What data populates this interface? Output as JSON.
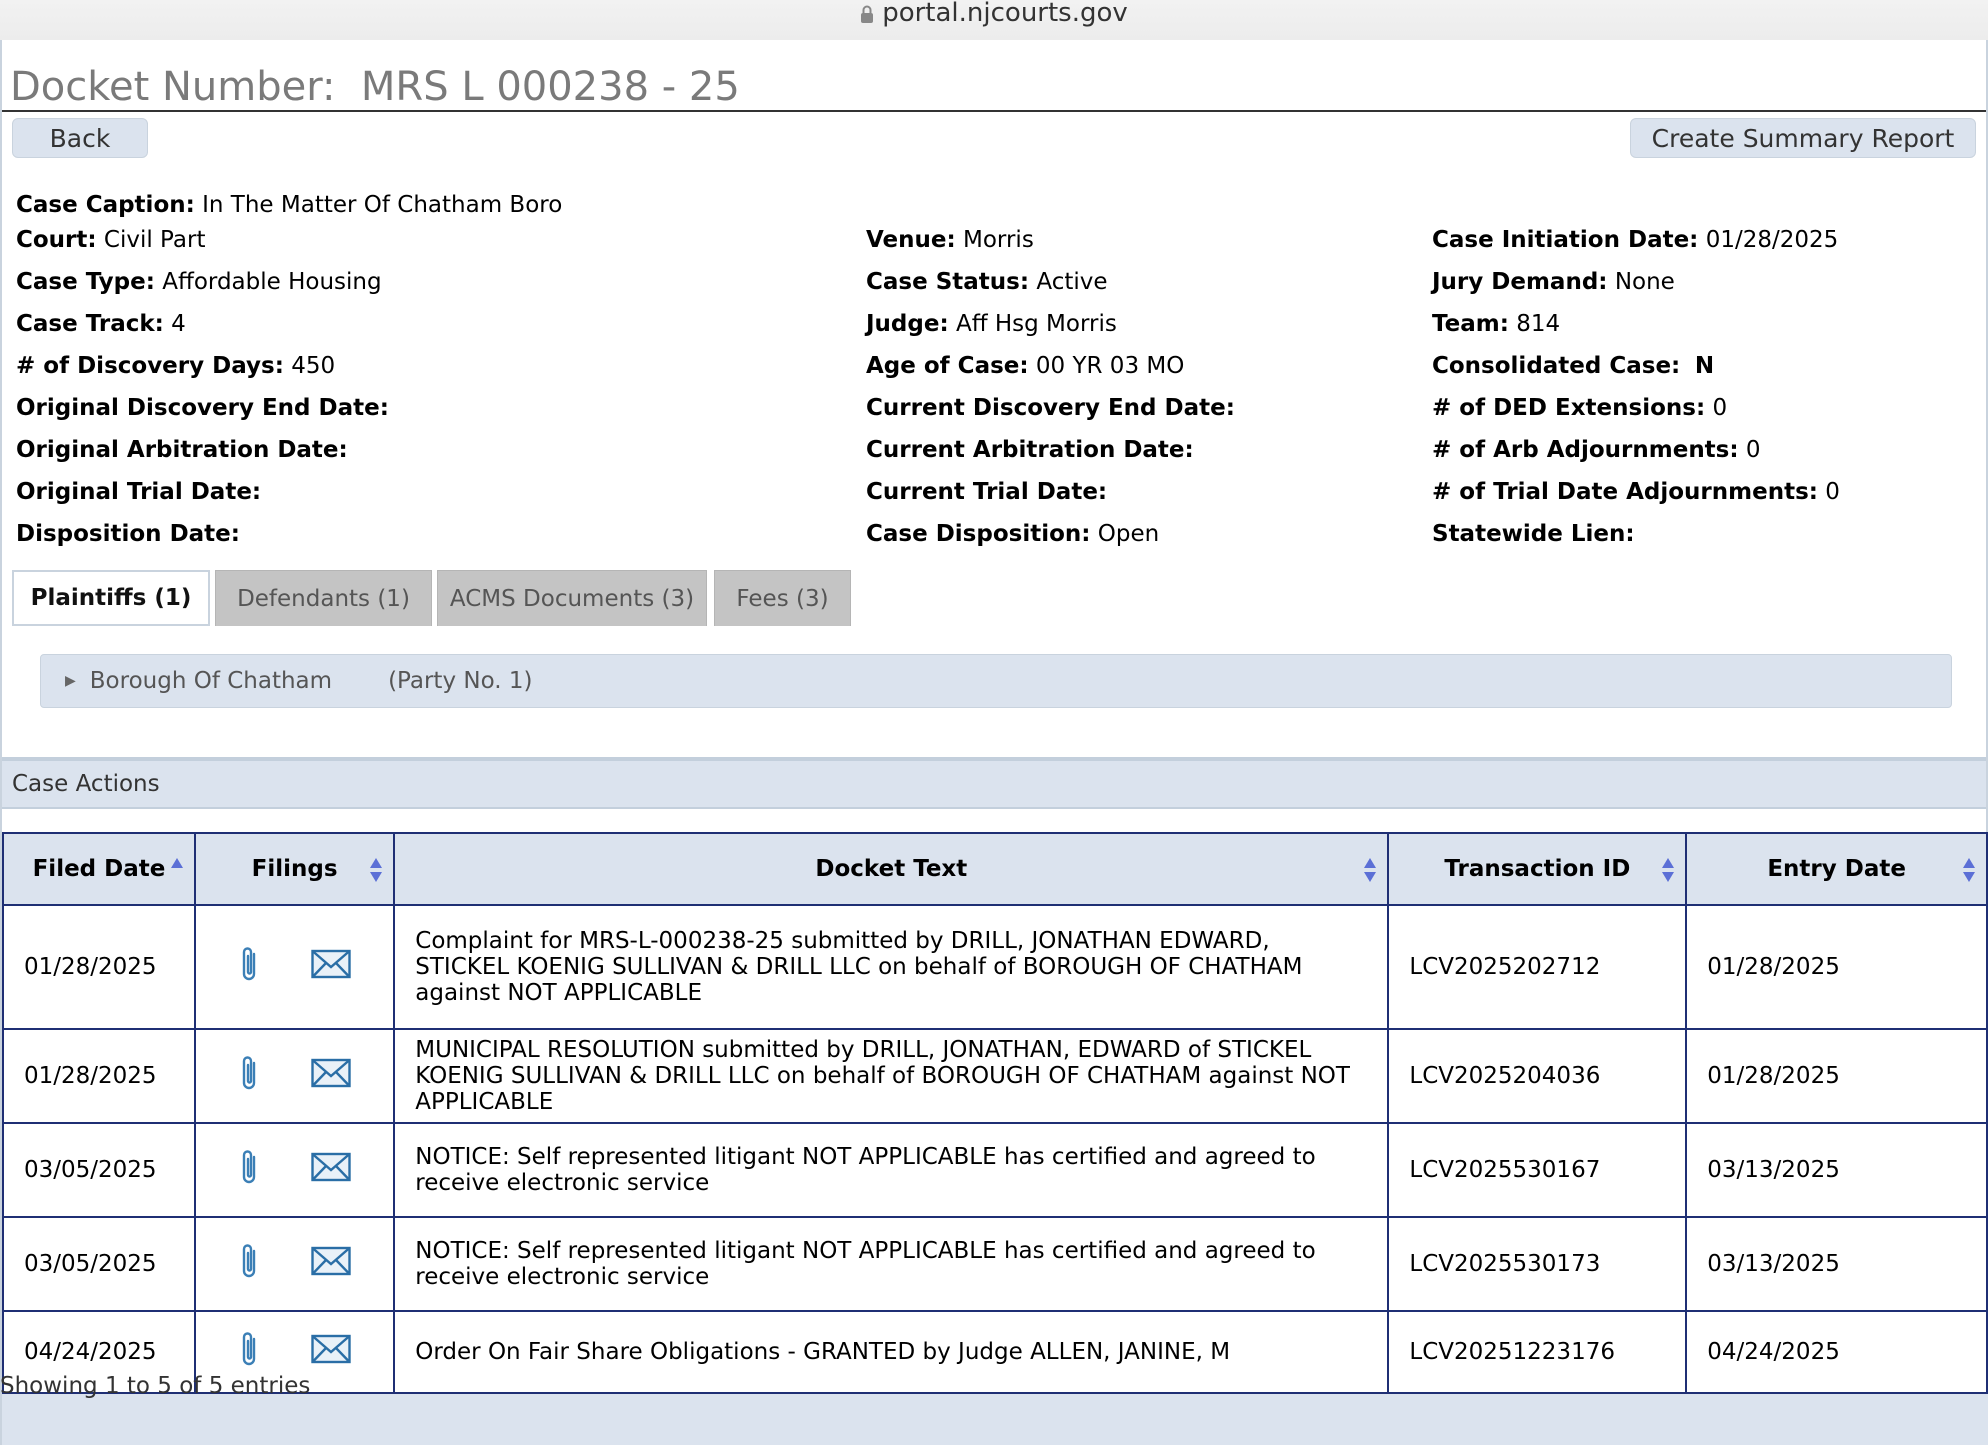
{
  "browser": {
    "url": "portal.njcourts.gov"
  },
  "header": {
    "docket_label": "Docket Number:",
    "docket_number": "MRS L 000238 - 25",
    "back_label": "Back",
    "summary_label": "Create Summary Report"
  },
  "case": {
    "caption_label": "Case Caption:",
    "caption": "In The Matter Of Chatham Boro",
    "court_label": "Court:",
    "court": "Civil Part",
    "venue_label": "Venue:",
    "venue": "Morris",
    "initiation_label": "Case Initiation Date:",
    "initiation": "01/28/2025",
    "type_label": "Case Type:",
    "type": "Affordable Housing",
    "status_label": "Case Status:",
    "status": "Active",
    "jury_label": "Jury Demand:",
    "jury": "None",
    "track_label": "Case Track:",
    "track": "4",
    "judge_label": "Judge:",
    "judge": "Aff Hsg Morris",
    "team_label": "Team:",
    "team": "814",
    "discovery_days_label": "# of Discovery Days:",
    "discovery_days": "450",
    "age_label": "Age of Case:",
    "age": "00 YR 03 MO",
    "consolidated_label": "Consolidated Case:",
    "consolidated": "N",
    "orig_disc_end_label": "Original Discovery End Date:",
    "curr_disc_end_label": "Current Discovery End Date:",
    "ded_ext_label": "# of DED Extensions:",
    "ded_ext": "0",
    "orig_arb_label": "Original Arbitration Date:",
    "curr_arb_label": "Current Arbitration Date:",
    "arb_adj_label": "# of Arb Adjournments:",
    "arb_adj": "0",
    "orig_trial_label": "Original Trial Date:",
    "curr_trial_label": "Current Trial Date:",
    "trial_adj_label": "# of Trial Date Adjournments:",
    "trial_adj": "0",
    "disposition_date_label": "Disposition Date:",
    "disposition_label": "Case Disposition:",
    "disposition": "Open",
    "lien_label": "Statewide Lien:"
  },
  "tabs": [
    {
      "label": "Plaintiffs  (1)"
    },
    {
      "label": "Defendants  (1)"
    },
    {
      "label": "ACMS Documents (3)"
    },
    {
      "label": "Fees (3)"
    }
  ],
  "party": {
    "name": "Borough Of Chatham",
    "number": "(Party No. 1)"
  },
  "case_actions": {
    "title": "Case Actions",
    "columns": [
      "Filed Date",
      "Filings",
      "Docket Text",
      "Transaction ID",
      "Entry Date"
    ],
    "rows": [
      {
        "filed": "01/28/2025",
        "text": "Complaint for MRS-L-000238-25 submitted by DRILL, JONATHAN EDWARD, STICKEL KOENIG SULLIVAN & DRILL LLC on behalf of BOROUGH OF CHATHAM against NOT APPLICABLE",
        "txn": "LCV2025202712",
        "entry": "01/28/2025"
      },
      {
        "filed": "01/28/2025",
        "text": "MUNICIPAL RESOLUTION submitted by DRILL, JONATHAN, EDWARD of STICKEL KOENIG SULLIVAN & DRILL LLC on behalf of BOROUGH OF CHATHAM against NOT APPLICABLE",
        "txn": "LCV2025204036",
        "entry": "01/28/2025"
      },
      {
        "filed": "03/05/2025",
        "text": "NOTICE: Self represented litigant NOT APPLICABLE has certified and agreed to receive electronic service",
        "txn": "LCV2025530167",
        "entry": "03/13/2025"
      },
      {
        "filed": "03/05/2025",
        "text": "NOTICE: Self represented litigant NOT APPLICABLE has certified and agreed to receive electronic service",
        "txn": "LCV2025530173",
        "entry": "03/13/2025"
      },
      {
        "filed": "04/24/2025",
        "text": "Order On Fair Share Obligations - GRANTED by Judge ALLEN, JANINE, M",
        "txn": "LCV20251223176",
        "entry": "04/24/2025"
      }
    ],
    "footer": "Showing 1 to 5 of 5 entries"
  },
  "icons": {
    "attachment": "paperclip-icon",
    "notice": "envelope-icon",
    "lock": "lock-icon"
  },
  "colors": {
    "accent": "#dbe3ee",
    "table_border": "#1f2f74",
    "sort_arrow": "#5b6fd6"
  }
}
